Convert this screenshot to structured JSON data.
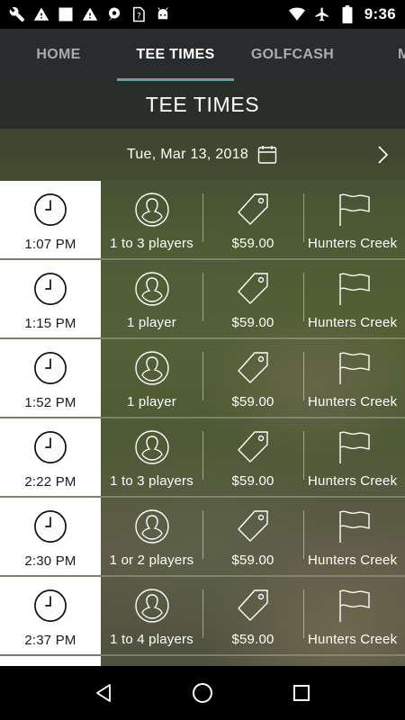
{
  "status_bar": {
    "time": "9:36",
    "left_icons": [
      "wrench-icon",
      "warning-icon",
      "square-icon",
      "warning-icon",
      "location-bubble-icon",
      "sim-question-icon",
      "android-icon"
    ],
    "right_icons": [
      "wifi-icon",
      "airplane-icon",
      "battery-icon"
    ]
  },
  "tabs": [
    {
      "label": "HOME",
      "active": false
    },
    {
      "label": "TEE TIMES",
      "active": true
    },
    {
      "label": "GOLFCASH",
      "active": false
    },
    {
      "label": "M",
      "active": false
    }
  ],
  "page": {
    "title": "TEE TIMES",
    "date": "Tue, Mar 13, 2018"
  },
  "tee_times": [
    {
      "time": "1:07 PM",
      "players": "1 to 3 players",
      "price": "$59.00",
      "course": "Hunters Creek"
    },
    {
      "time": "1:15 PM",
      "players": "1 player",
      "price": "$59.00",
      "course": "Hunters Creek"
    },
    {
      "time": "1:52 PM",
      "players": "1 player",
      "price": "$59.00",
      "course": "Hunters Creek"
    },
    {
      "time": "2:22 PM",
      "players": "1 to 3 players",
      "price": "$59.00",
      "course": "Hunters Creek"
    },
    {
      "time": "2:30 PM",
      "players": "1 or 2 players",
      "price": "$59.00",
      "course": "Hunters Creek"
    },
    {
      "time": "2:37 PM",
      "players": "1 to 4 players",
      "price": "$59.00",
      "course": "Hunters Creek"
    }
  ],
  "nav_bar": [
    "back-icon",
    "home-icon",
    "recents-icon"
  ],
  "colors": {
    "tab_bar": "#2a2b2c",
    "tab_indicator": "#5aa9a8",
    "inactive_tab_text": "#a9abad"
  }
}
